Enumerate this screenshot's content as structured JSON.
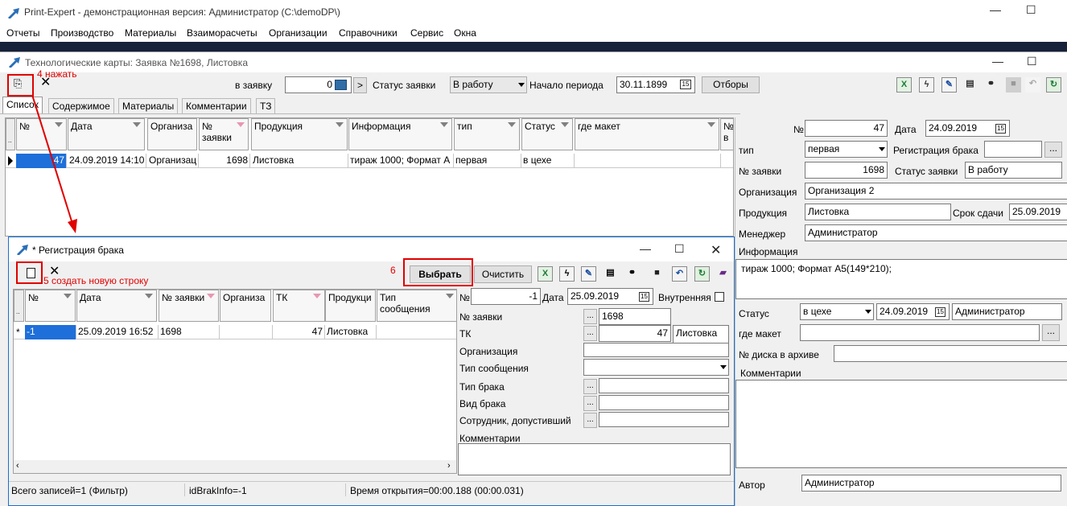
{
  "app": {
    "title": "Print-Expert - демонстрационная версия: Администратор (C:\\demoDP\\)",
    "menu": [
      "Отчеты",
      "Производство",
      "Материалы",
      "Взаиморасчеты",
      "Организации",
      "Справочники",
      "Сервис",
      "Окна"
    ]
  },
  "tech_window": {
    "title": "Технологические карты: Заявка №1698, Листовка",
    "annotation_4": "4 нажать",
    "toolbar": {
      "to_order_label": "в заявку",
      "to_order_value": "0",
      "next_btn": ">",
      "order_status_label": "Статус заявки",
      "order_status_value": "В работу",
      "period_start_label": "Начало периода",
      "period_start_value": "30.11.1899",
      "filters_button": "Отборы",
      "cal_glyph": "15"
    },
    "tabs": [
      "Список",
      "Содержимое",
      "Материалы",
      "Комментарии",
      "ТЗ"
    ],
    "grid": {
      "headers": [
        "№",
        "Дата",
        "Организа",
        "№ заявки",
        "Продукция",
        "Информация",
        "тип",
        "Статус",
        "где макет",
        "№ в"
      ],
      "row": [
        "47",
        "24.09.2019 14:10",
        "Организац",
        "1698",
        "Листовка",
        "тираж 1000; Формат А",
        "первая",
        "в цехе",
        ""
      ]
    }
  },
  "right_panel": {
    "no_label": "№",
    "no_value": "47",
    "date_label": "Дата",
    "date_value": "24.09.2019",
    "type_label": "тип",
    "type_value": "первая",
    "defect_reg_label": "Регистрация брака",
    "defect_reg_value": "",
    "order_no_label": "№ заявки",
    "order_no_value": "1698",
    "order_status_label": "Статус заявки",
    "order_status_value": "В работу",
    "org_label": "Организация",
    "org_value": "Организация 2",
    "product_label": "Продукция",
    "product_value": "Листовка",
    "deadline_label": "Срок сдачи",
    "deadline_value": "25.09.2019",
    "manager_label": "Менеджер",
    "manager_value": "Администратор",
    "info_label": "Информация",
    "info_value": "тираж 1000; Формат А5(149*210);",
    "status_label": "Статус",
    "status_value": "в цехе",
    "status_date": "24.09.2019",
    "status_user": "Администратор",
    "layout_label": "где макет",
    "layout_value": "",
    "disk_label": "№ диска в архиве",
    "disk_value": "",
    "comments_label": "Комментарии",
    "comments_value": "",
    "author_label": "Автор",
    "author_value": "Администратор"
  },
  "defect_window": {
    "title": "* Регистрация брака",
    "annotation_5": "5 создать новую строку",
    "annotation_6": "6",
    "select_button": "Выбрать",
    "clear_button": "Очистить",
    "grid": {
      "headers": [
        "№",
        "Дата",
        "№ заявки",
        "Организа",
        "ТК",
        "Продукци",
        "Тип сообщения"
      ],
      "row": [
        "-1",
        "25.09.2019 16:52",
        "1698",
        "",
        "47",
        "Листовка",
        ""
      ],
      "row_marker": "*"
    },
    "form": {
      "no_label": "№",
      "no_value": "-1",
      "date_label": "Дата",
      "date_value": "25.09.2019",
      "internal_label": "Внутренняя",
      "order_no_label": "№ заявки",
      "order_no_value": "1698",
      "tk_label": "ТК",
      "tk_value": "47",
      "tk_product": "Листовка",
      "org_label": "Организация",
      "org_value": "",
      "msg_type_label": "Тип сообщения",
      "msg_type_value": "",
      "defect_type_label": "Тип брака",
      "defect_type_value": "",
      "defect_kind_label": "Вид брака",
      "defect_kind_value": "",
      "employee_label": "Сотрудник, допустивший",
      "employee_value": "",
      "comments_label": "Комментарии",
      "comments_value": ""
    },
    "statusbar": {
      "records": "Всего записей=1 (Фильтр)",
      "id_info": "idBrakInfo=-1",
      "open_time": "Время открытия=00:00.188 (00:00.031)"
    }
  }
}
